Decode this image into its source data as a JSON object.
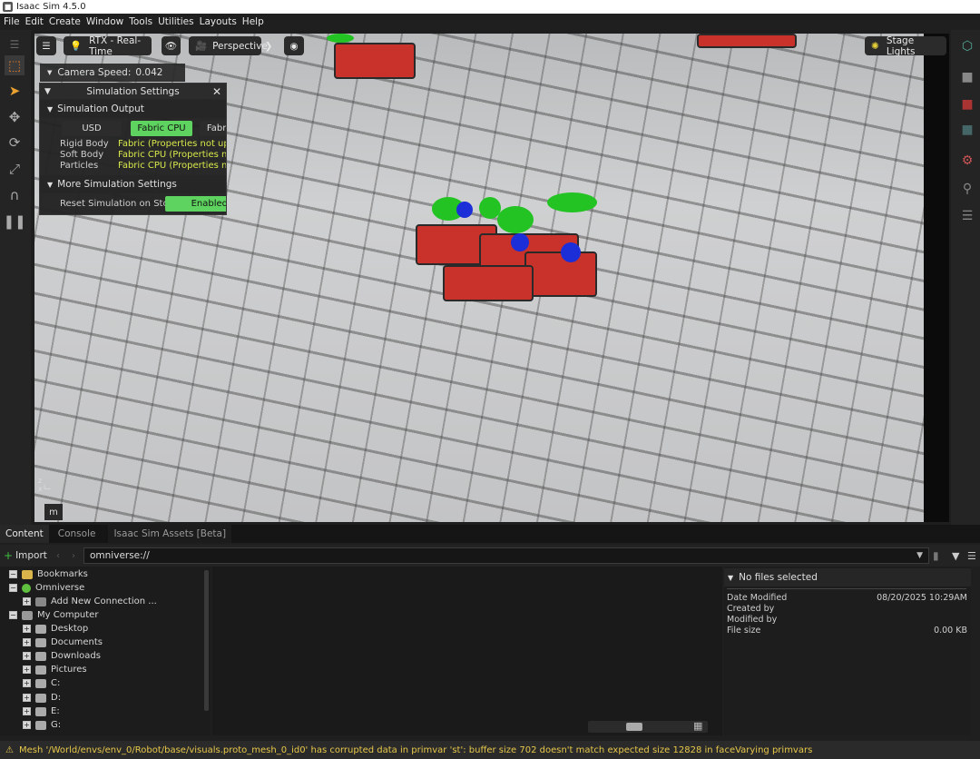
{
  "window": {
    "title": "Isaac Sim 4.5.0"
  },
  "menu": [
    "File",
    "Edit",
    "Create",
    "Window",
    "Tools",
    "Utilities",
    "Layouts",
    "Help"
  ],
  "viewport": {
    "render_mode": "RTX - Real-Time",
    "camera": "Perspective",
    "lights": "Stage Lights",
    "camera_speed_label": "Camera Speed:",
    "camera_speed": "0.042",
    "m_key": "m"
  },
  "sim_settings": {
    "title": "Simulation Settings",
    "output_section": "Simulation Output",
    "modes": [
      "USD",
      "Fabric CPU",
      "Fabri"
    ],
    "active_mode": "Fabric CPU",
    "rows": [
      {
        "label": "Rigid Body",
        "value": "Fabric (Properties not upda"
      },
      {
        "label": "Soft Body",
        "value": "Fabric CPU (Properties not u"
      },
      {
        "label": "Particles",
        "value": "Fabric CPU (Properties not u"
      }
    ],
    "more_section": "More Simulation Settings",
    "reset_label": "Reset Simulation on Stop",
    "reset_value": "Enabled"
  },
  "content": {
    "tabs": [
      "Content",
      "Console",
      "Isaac Sim Assets [Beta]"
    ],
    "import_label": "Import",
    "path": "omniverse://",
    "tree": {
      "bookmarks": "Bookmarks",
      "omniverse": "Omniverse",
      "add_connection": "Add New Connection ...",
      "my_computer": "My Computer",
      "desktop": "Desktop",
      "documents": "Documents",
      "downloads": "Downloads",
      "pictures": "Pictures",
      "c": "C:",
      "d": "D:",
      "e": "E:",
      "g": "G:"
    },
    "info": {
      "header": "No files selected",
      "date_modified_label": "Date Modified",
      "date_modified": "08/20/2025 10:29AM",
      "created_by_label": "Created by",
      "modified_by_label": "Modified by",
      "file_size_label": "File size",
      "file_size": "0.00 KB"
    }
  },
  "status": "Mesh '/World/envs/env_0/Robot/base/visuals.proto_mesh_0_id0' has corrupted data in primvar 'st': buffer size 702 doesn't match expected size 12828 in faceVarying primvars",
  "colors": {
    "accent_green": "#5fd35f",
    "warning": "#e8c84a"
  }
}
